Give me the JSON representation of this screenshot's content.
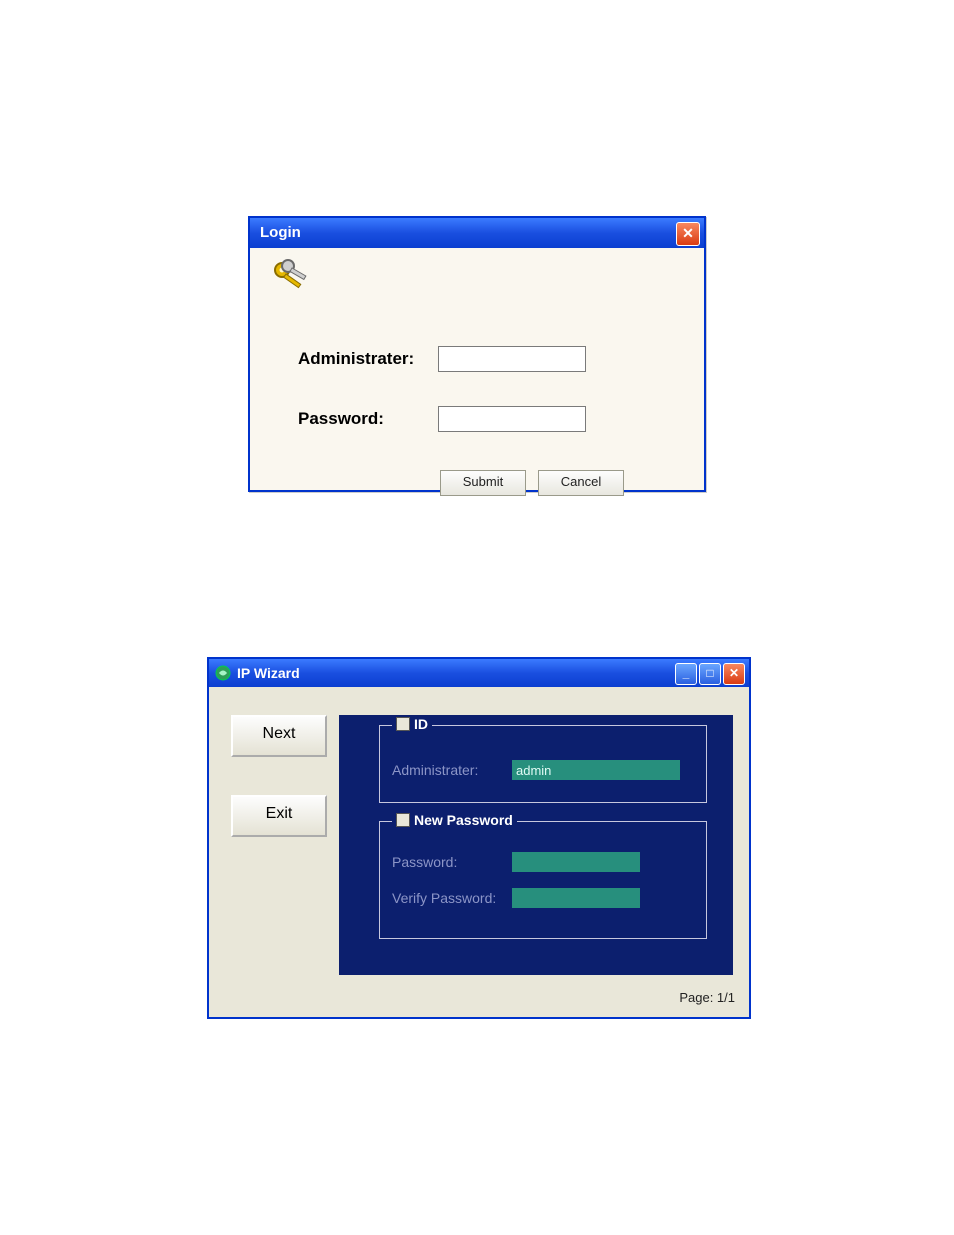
{
  "login": {
    "title": "Login",
    "admin_label": "Administrater:",
    "password_label": "Password:",
    "admin_value": "",
    "password_value": "",
    "submit_label": "Submit",
    "cancel_label": "Cancel",
    "close_glyph": "✕"
  },
  "wizard": {
    "title": "IP Wizard",
    "next_label": "Next",
    "exit_label": "Exit",
    "id_legend": "ID",
    "newpw_legend": "New Password",
    "admin_label": "Administrater:",
    "admin_value": "admin",
    "pw_label": "Password:",
    "pw_value": "",
    "vpw_label": "Verify Password:",
    "vpw_value": "",
    "page_label": "Page: 1/1",
    "min_glyph": "_",
    "max_glyph": "□",
    "close_glyph": "✕"
  }
}
